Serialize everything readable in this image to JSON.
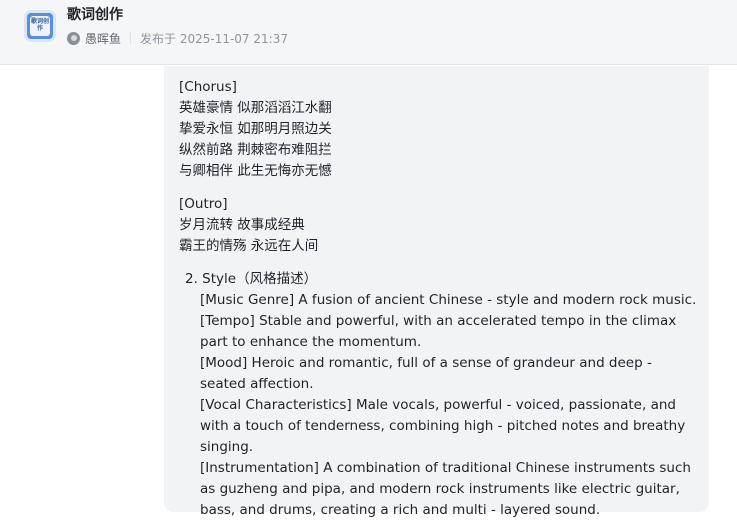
{
  "app": {
    "title": "歌词创作",
    "logo_text": "歌词创作"
  },
  "post_meta": {
    "author": "愚晖鱼",
    "published": "发布于 2025-11-07 21:37"
  },
  "lyrics": {
    "chorus": {
      "tag": "[Chorus]",
      "lines": [
        "英雄豪情 似那滔滔江水翻",
        "挚爱永恒 如那明月照边关",
        "纵然前路 荆棘密布难阻拦",
        "与卿相伴 此生无悔亦无憾"
      ]
    },
    "outro": {
      "tag": "[Outro]",
      "lines": [
        "岁月流转 故事成经典",
        "霸王的情殇 永远在人间"
      ]
    }
  },
  "style": {
    "heading": "2. Style（风格描述）",
    "items": [
      "[Music Genre] A fusion of ancient Chinese - style and modern rock music.",
      "[Tempo] Stable and powerful, with an accelerated tempo in the climax part to enhance the momentum.",
      "[Mood] Heroic and romantic, full of a sense of grandeur and deep - seated affection.",
      "[Vocal Characteristics] Male vocals, powerful - voiced, passionate, and with a touch of tenderness, combining high - pitched notes and breathy singing.",
      "[Instrumentation] A combination of traditional Chinese instruments such as guzheng and pipa, and modern rock instruments like electric guitar, bass, and drums, creating a rich and multi - layered sound."
    ]
  },
  "colors": {
    "header_bg": "#f5f6f7",
    "card_bg": "#f2f3f5",
    "text": "#1f2329",
    "muted": "#8f959e"
  }
}
